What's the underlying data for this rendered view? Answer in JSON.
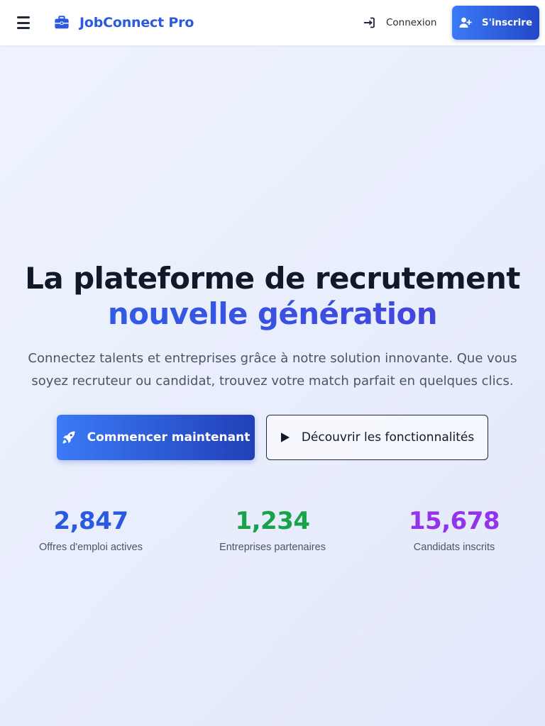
{
  "header": {
    "brand": "JobConnect Pro",
    "login_label": "Connexion",
    "signup_label": "S'inscrire"
  },
  "hero": {
    "title_line1": "La plateforme de recrutement",
    "title_line2": "nouvelle génération",
    "subtitle": "Connectez talents et entreprises grâce à notre solution innovante. Que vous soyez recruteur ou candidat, trouvez votre match parfait en quelques clics.",
    "cta_primary": "Commencer maintenant",
    "cta_secondary": "Découvrir les fonctionnalités"
  },
  "stats": [
    {
      "value": "2,847",
      "label": "Offres d'emploi actives",
      "color": "#2b59e0"
    },
    {
      "value": "1,234",
      "label": "Entreprises partenaires",
      "color": "#16a34a"
    },
    {
      "value": "15,678",
      "label": "Candidats inscrits",
      "color": "#9333ea"
    }
  ],
  "icons": {
    "menu": "hamburger-icon",
    "brand": "briefcase-icon",
    "login": "sign-in-icon",
    "signup": "user-plus-icon",
    "cta_primary": "rocket-icon",
    "cta_secondary": "play-icon"
  },
  "colors": {
    "accent": "#2b59e0",
    "button_gradient_start": "#3b7af6",
    "button_gradient_end": "#2140b8"
  }
}
